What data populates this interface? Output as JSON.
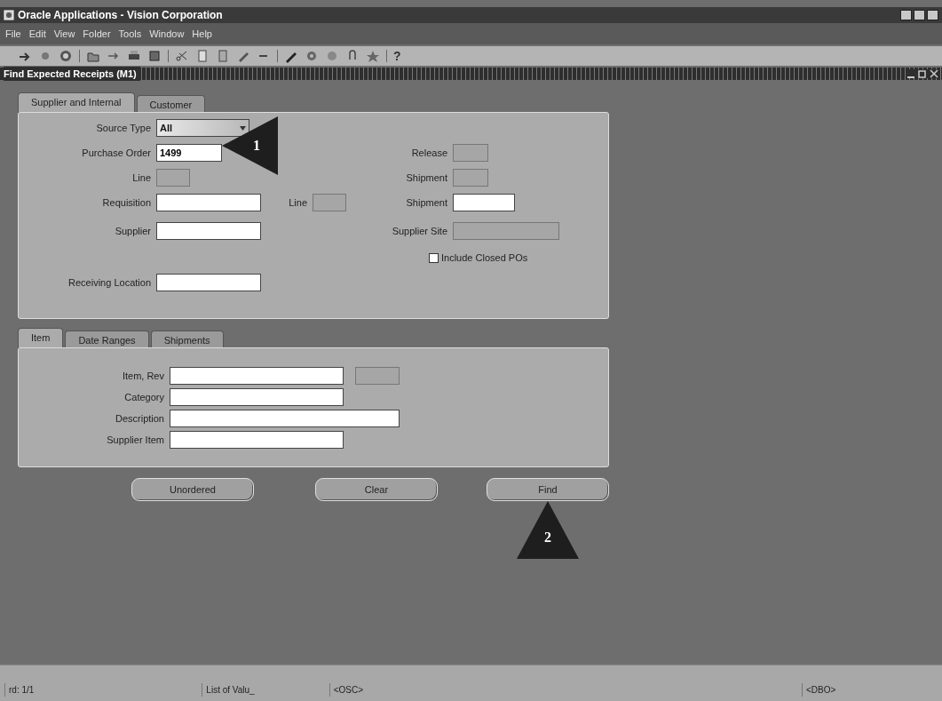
{
  "window": {
    "title": "Oracle Applications - Vision Corporation"
  },
  "menu": [
    "File",
    "Edit",
    "View",
    "Folder",
    "Tools",
    "Window",
    "Help"
  ],
  "toolbar": {
    "help": "?"
  },
  "form": {
    "title": "Find Expected Receipts (M1)",
    "source_tabs": [
      {
        "label": "Supplier and Internal",
        "selected": true
      },
      {
        "label": "Customer",
        "selected": false
      }
    ],
    "rows": [
      {
        "left": {
          "kind": "dropdown",
          "label": "Source Type",
          "value": "All"
        }
      },
      {
        "left": {
          "kind": "text",
          "label": "Purchase Order",
          "value": "1499",
          "disabled": false
        },
        "right": {
          "kind": "text",
          "label": "Release",
          "disabled": true
        }
      },
      {
        "left": {
          "kind": "text",
          "label": "Line",
          "disabled": true
        },
        "right": {
          "kind": "text",
          "label": "Shipment",
          "disabled": true
        }
      },
      {
        "left": {
          "kind": "text",
          "label": "Requisition",
          "disabled": false
        },
        "middle": {
          "kind": "text",
          "label": "Line",
          "disabled": true
        },
        "right": {
          "kind": "text",
          "label": "Shipment",
          "disabled": false
        }
      },
      {
        "left": {
          "kind": "text",
          "label": "Supplier",
          "disabled": false
        },
        "right": {
          "kind": "text",
          "label": "Supplier Site",
          "disabled": true
        }
      },
      {
        "right": {
          "kind": "checkbox",
          "label": "Include Closed POs",
          "checked": false
        }
      },
      {
        "left": {
          "kind": "text",
          "label": "Receiving Location",
          "disabled": false
        }
      }
    ],
    "detail_tabs": [
      {
        "label": "Item",
        "selected": true
      },
      {
        "label": "Date Ranges",
        "selected": false
      },
      {
        "label": "Shipments",
        "selected": false
      }
    ],
    "detail_fields": [
      {
        "label": "Item, Rev",
        "disabled": false,
        "extra": {
          "disabled": true
        }
      },
      {
        "label": "Category",
        "disabled": false
      },
      {
        "label": "Description",
        "disabled": false
      },
      {
        "label": "Supplier Item",
        "disabled": false
      }
    ],
    "buttons": [
      "Unordered",
      "Clear",
      "Find"
    ]
  },
  "callouts": [
    {
      "text": "1"
    },
    {
      "text": "2"
    }
  ],
  "status_bar": [
    "rd: 1/1",
    "List of Valu_",
    "<OSC>",
    "<DBO>"
  ]
}
